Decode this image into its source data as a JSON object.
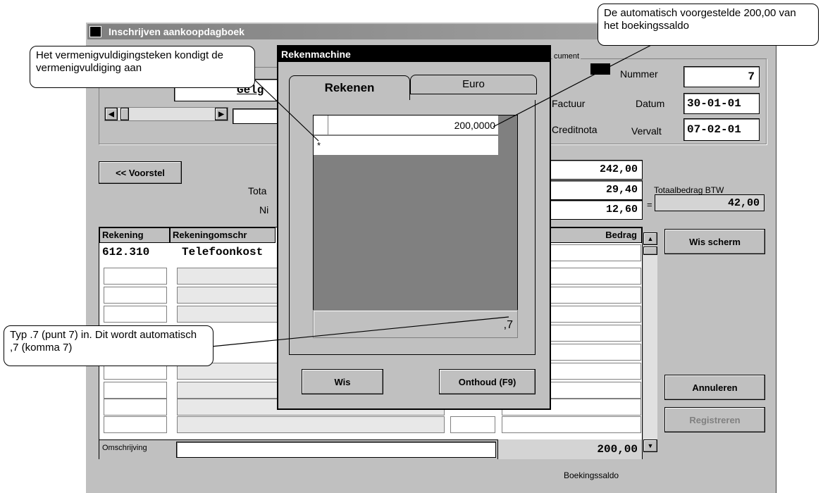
{
  "window": {
    "title": "Inschrijven aankoopdagboek"
  },
  "document_group": {
    "label": "cument",
    "nummer_label": "Nummer",
    "nummer_value": "7",
    "factuur_label": "Factuur",
    "creditnota_label": "Creditnota",
    "datum_label": "Datum",
    "datum_value": "30-01-01",
    "vervalt_label": "Vervalt",
    "vervalt_value": "07-02-01"
  },
  "left_panel": {
    "partial_label": "Gelg",
    "voorstel_button": "<< Voorstel",
    "tota_label": "Tota",
    "ni_label": "Ni"
  },
  "amounts": {
    "total": "242,00",
    "btw1": "29,40",
    "btw2": "12,60",
    "totaal_btw_label": "Totaalbedrag BTW",
    "equals": "=",
    "totaal_btw_value": "42,00"
  },
  "table": {
    "headers": [
      "Rekening",
      "Rekeningomschr",
      "Bedrag"
    ],
    "rows": [
      {
        "rekening": "612.310",
        "omschrijving": "Telefoonkost"
      }
    ],
    "omschrijving_label": "Omschrijving",
    "saldo_value": "200,00",
    "saldo_label": "Boekingssaldo"
  },
  "buttons": {
    "wis_scherm": "Wis scherm",
    "annuleren": "Annuleren",
    "registreren": "Registreren"
  },
  "calculator": {
    "title": "Rekenmachine",
    "tabs": [
      "Rekenen",
      "Euro"
    ],
    "tape_value": "200,0000",
    "tape_op": "*",
    "display": ",7",
    "wis_button": "Wis",
    "onthoud_button": "Onthoud (F9)"
  },
  "callouts": {
    "top_left": "Het vermenigvuldigingsteken kondigt de vermenigvuldiging aan",
    "top_right": "De automatisch voorgestelde 200,00 van het boekingssaldo",
    "bottom_left": "Typ .7 (punt 7) in. Dit wordt automatisch ,7 (komma 7)"
  }
}
